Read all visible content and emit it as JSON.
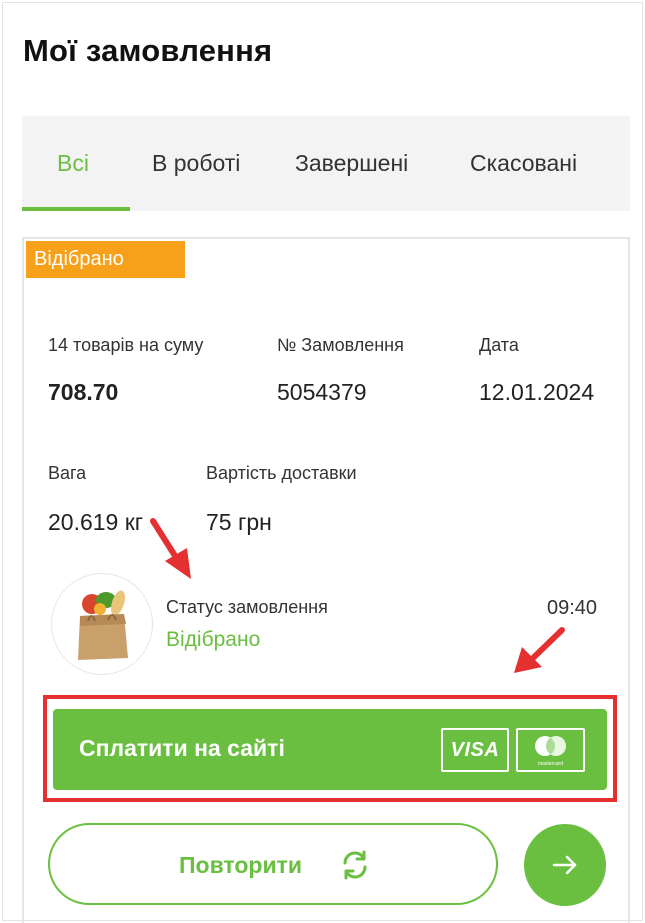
{
  "page": {
    "title": "Мої замовлення"
  },
  "tabs": [
    {
      "label": "Всі",
      "active": true
    },
    {
      "label": "В роботі",
      "active": false
    },
    {
      "label": "Завершені",
      "active": false
    },
    {
      "label": "Скасовані",
      "active": false
    }
  ],
  "order": {
    "status_badge": "Відібрано",
    "items_label": "14 товарів на суму",
    "items_sum": "708.70",
    "number_label": "№ Замовлення",
    "number_value": "5054379",
    "date_label": "Дата",
    "date_value": "12.01.2024",
    "weight_label": "Вага",
    "weight_value": "20.619 кг",
    "delivery_label": "Вартість доставки",
    "delivery_value": "75 грн",
    "status_label": "Статус замовлення",
    "status_value": "Відібрано",
    "status_time": "09:40",
    "pay_label": "Сплатити на сайті",
    "visa_text": "VISA",
    "mastercard_text": "mastercard",
    "repeat_label": "Повторити"
  },
  "colors": {
    "accent": "#6abf40",
    "badge": "#f7a11b",
    "annotation": "#e53030"
  },
  "icons": {
    "grocery_bag": "grocery-bag-icon",
    "refresh": "refresh-icon",
    "arrow_right": "arrow-right-icon",
    "visa": "visa-icon",
    "mastercard": "mastercard-icon"
  }
}
